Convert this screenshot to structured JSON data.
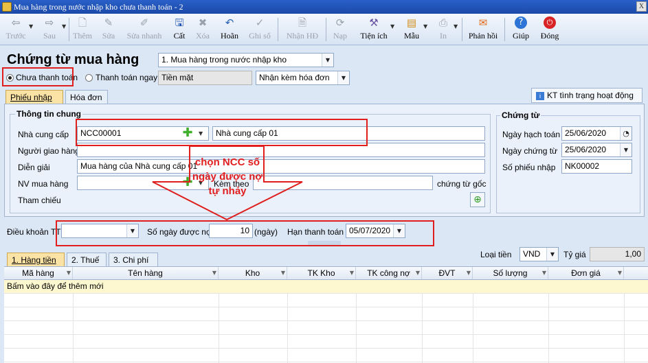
{
  "window": {
    "title": "Mua hàng trong nước nhập kho chưa thanh toán - 2",
    "close_label": "X"
  },
  "toolbar": {
    "items": [
      {
        "label": "Trước",
        "icon": "arrow-left-icon"
      },
      {
        "label": "Sau",
        "icon": "arrow-right-icon"
      },
      {
        "label": "Thêm",
        "icon": "add-document-icon"
      },
      {
        "label": "Sửa",
        "icon": "edit-icon"
      },
      {
        "label": "Sửa nhanh",
        "icon": "quick-edit-icon"
      },
      {
        "label": "Cất",
        "icon": "save-icon"
      },
      {
        "label": "Xóa",
        "icon": "delete-icon"
      },
      {
        "label": "Hoãn",
        "icon": "undo-icon"
      },
      {
        "label": "Ghi sổ",
        "icon": "post-icon"
      },
      {
        "label": "Nhận HĐ",
        "icon": "receive-invoice-icon"
      },
      {
        "label": "Nạp",
        "icon": "reload-icon"
      },
      {
        "label": "Tiện ích",
        "icon": "utilities-icon"
      },
      {
        "label": "Mẫu",
        "icon": "template-icon"
      },
      {
        "label": "In",
        "icon": "print-icon"
      },
      {
        "label": "Phản hồi",
        "icon": "feedback-icon"
      },
      {
        "label": "Giúp",
        "icon": "help-icon"
      },
      {
        "label": "Đóng",
        "icon": "close-icon"
      }
    ]
  },
  "header": {
    "form_title": "Chứng từ mua hàng",
    "purchase_type": "1. Mua hàng trong nước nhập kho",
    "payment_unpaid": "Chưa thanh toán",
    "payment_now": "Thanh toán ngay",
    "payment_method": "Tiền mặt",
    "invoice_option": "Nhận kèm hóa đơn"
  },
  "tabs": {
    "receipt": "Phiếu nhập",
    "invoice": "Hóa đơn",
    "check_status": "KT tình trạng hoạt động DN"
  },
  "general": {
    "title": "Thông tin chung",
    "supplier_label": "Nhà cung cấp",
    "supplier_code": "NCC00001",
    "supplier_name": "Nhà cung cấp 01",
    "deliverer_label": "Người giao hàng",
    "deliverer_value": "",
    "description_label": "Diễn giải",
    "description_value": "Mua hàng của Nhà cung cấp 01",
    "buyer_label": "NV mua hàng",
    "buyer_value": "",
    "attached_label": "Kèm theo",
    "attached_value": "",
    "original_docs_label": "chứng từ gốc",
    "reference_label": "Tham chiếu"
  },
  "voucher": {
    "title": "Chứng từ",
    "posting_date_label": "Ngày hạch toán",
    "posting_date": "25/06/2020",
    "voucher_date_label": "Ngày chứng từ",
    "voucher_date": "25/06/2020",
    "voucher_no_label": "Số phiếu nhập",
    "voucher_no": "NK00002"
  },
  "payment_terms": {
    "terms_label": "Điều khoản TT",
    "terms_value": "",
    "days_label": "Số ngày được nợ",
    "days_value": "10",
    "days_unit": "(ngày)",
    "due_label": "Hạn thanh toán",
    "due_value": "05/07/2020"
  },
  "annotation": {
    "text": "chọn NCC số ngày được nợ tự nhảy",
    "color": "#e01e1e"
  },
  "detail_tabs": [
    "1. Hàng tiền",
    "2. Thuế",
    "3. Chi phí"
  ],
  "currency": {
    "label": "Loại tiền",
    "value": "VND",
    "rate_label": "Tỷ giá",
    "rate_value": "1,00"
  },
  "grid": {
    "columns": [
      "Mã hàng",
      "Tên hàng",
      "Kho",
      "TK Kho",
      "TK công nợ",
      "ĐVT",
      "Số lượng",
      "Đơn giá"
    ],
    "add_row_hint": "Bấm vào đây để thêm mới"
  }
}
